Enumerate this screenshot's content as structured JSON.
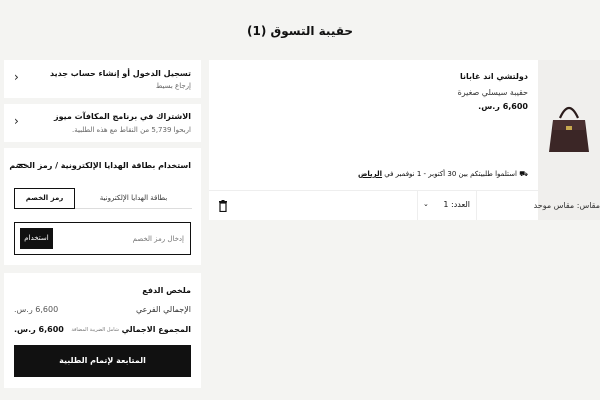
{
  "page": {
    "title": "حقيبة التسوق (1)"
  },
  "login": {
    "title": "تسجيل الدخول أو إنشاء حساب جديد",
    "subtitle": "إرجاع بسيط"
  },
  "rewards": {
    "title": "الاشتراك في برنامج المكافآت ميوز",
    "subtitle": "اربحوا 5,739 من النقاط مع هذه الطلبية."
  },
  "gift": {
    "title": "استخدام بطاقة الهدايا الإلكترونية / رمز الخصم",
    "collapse_symbol": "—",
    "tabs": [
      "بطاقة الهدايا الإلكترونية",
      "رمز الخصم"
    ],
    "input_placeholder": "إدخال رمز الخصم",
    "apply_label": "استخدام"
  },
  "summary": {
    "title": "ملخص الدفع",
    "subtotal_label": "الإجمالي الفرعي",
    "subtotal_value": "6,600 ر.س.",
    "total_label": "المجموع الاجمالي",
    "total_note": "شامل الضريبة المضافة",
    "total_value": "6,600 ر.س.",
    "checkout_label": "المتابعة لإتمام الطلبية"
  },
  "product": {
    "brand": "دولتشي اند غابانا",
    "name": "حقيبة سيسلي صغيرة",
    "price": "6,600 ر.س.",
    "delivery_text": "استلموا طلبيتكم بين 30 أكتوبر - 1 نوفمبر في",
    "delivery_city": "الرياض",
    "size_label": "مقاس: مقاس موحد",
    "qty_label": "العدد: 1"
  },
  "icons": {
    "chevron": "chevron-left-icon",
    "delete": "trash-icon",
    "truck": "truck-icon",
    "dropdown": "chevron-down-icon"
  }
}
